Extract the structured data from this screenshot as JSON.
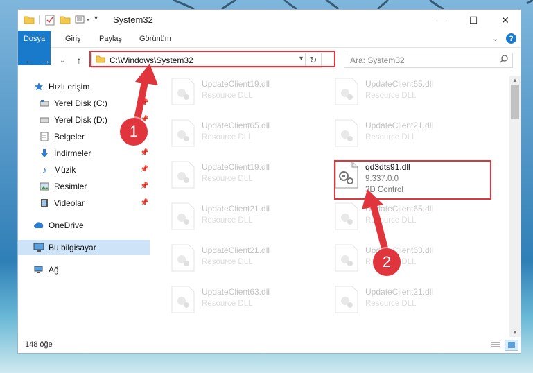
{
  "window": {
    "title": "System32",
    "controls": {
      "minimize": "—",
      "maximize": "☐",
      "close": "✕"
    }
  },
  "ribbon": {
    "tabs": [
      {
        "label": "Dosya",
        "active": true
      },
      {
        "label": "Giriş"
      },
      {
        "label": "Paylaş"
      },
      {
        "label": "Görünüm"
      }
    ],
    "help_icon": "?"
  },
  "navigation": {
    "back_icon": "←",
    "forward_icon": "→",
    "recent_icon": "⌄",
    "up_icon": "↑",
    "address": "C:\\Windows\\System32",
    "refresh_icon": "↻",
    "search_placeholder": "Ara: System32"
  },
  "sidebar": {
    "items": [
      {
        "label": "Hızlı erişim",
        "icon": "star-icon"
      },
      {
        "label": "Yerel Disk (C:)",
        "icon": "drive-icon",
        "pinned": true
      },
      {
        "label": "Yerel Disk (D:)",
        "icon": "drive-icon",
        "pinned": true
      },
      {
        "label": "Belgeler",
        "icon": "documents-icon",
        "pinned": true
      },
      {
        "label": "İndirmeler",
        "icon": "download-icon",
        "pinned": true
      },
      {
        "label": "Müzik",
        "icon": "music-icon",
        "pinned": true
      },
      {
        "label": "Resimler",
        "icon": "pictures-icon",
        "pinned": true
      },
      {
        "label": "Videolar",
        "icon": "videos-icon",
        "pinned": true
      },
      {
        "label": "OneDrive",
        "icon": "cloud-icon"
      },
      {
        "label": "Bu bilgisayar",
        "icon": "computer-icon",
        "selected": true
      },
      {
        "label": "Ağ",
        "icon": "network-icon"
      }
    ]
  },
  "files": [
    {
      "name": "UpdateClient19.dll",
      "type": "Resource DLL"
    },
    {
      "name": "UpdateClient65.dll",
      "type": "Resource DLL"
    },
    {
      "name": "UpdateClient65.dll",
      "type": "Resource DLL"
    },
    {
      "name": "UpdateClient21.dll",
      "type": "Resource DLL"
    },
    {
      "name": "UpdateClient19.dll",
      "type": "Resource DLL"
    },
    {
      "name": "qd3dts91.dll",
      "version": "9.337.0.0",
      "type": "3D Control",
      "highlighted": true
    },
    {
      "name": "UpdateClient21.dll",
      "type": "Resource DLL"
    },
    {
      "name": "UpdateClient65.dll",
      "type": "Resource DLL"
    },
    {
      "name": "UpdateClient21.dll",
      "type": "Resource DLL"
    },
    {
      "name": "UpdateClient63.dll",
      "type": "Resource DLL"
    },
    {
      "name": "UpdateClient63.dll",
      "type": "Resource DLL"
    },
    {
      "name": "UpdateClient21.dll",
      "type": "Resource DLL"
    }
  ],
  "status": {
    "item_count": "148 öğe"
  },
  "annotations": {
    "step1": "1",
    "step2": "2",
    "color": "#e0353d"
  }
}
